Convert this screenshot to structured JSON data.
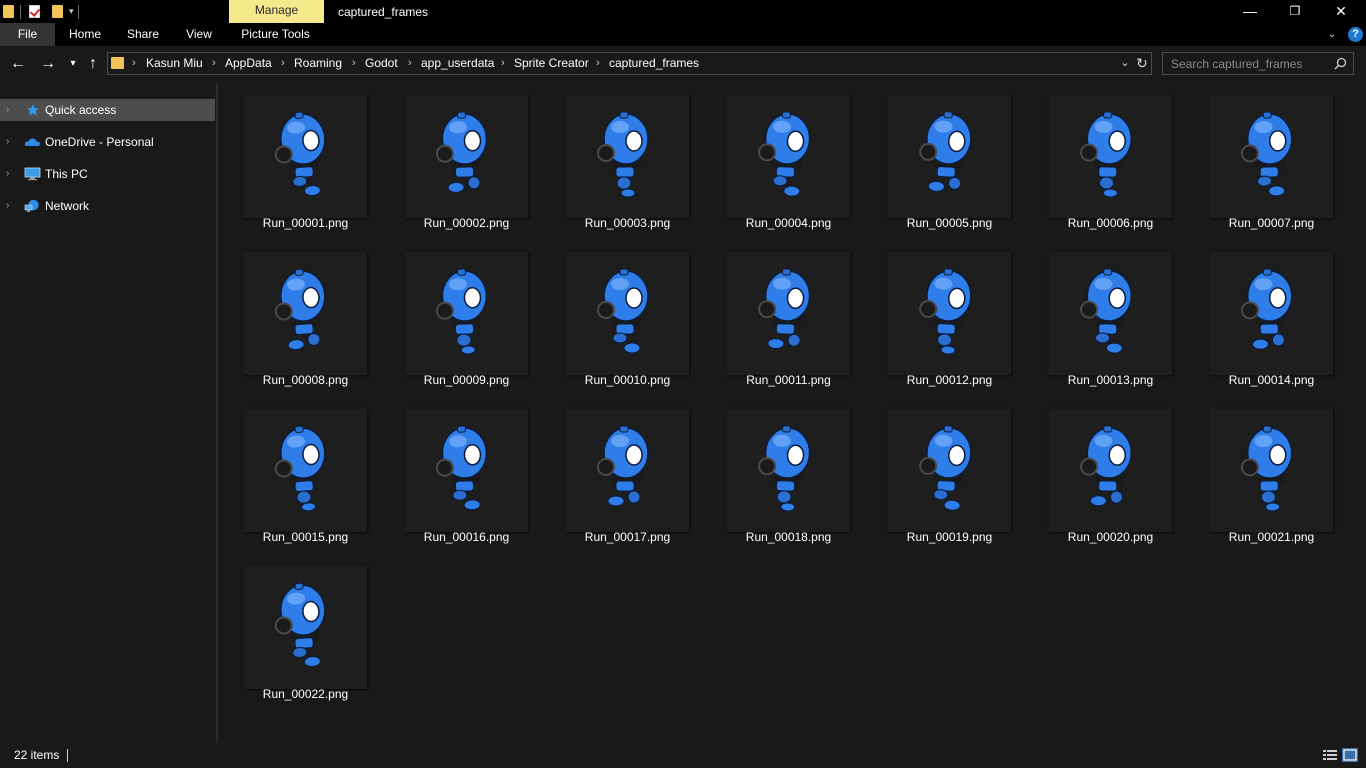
{
  "titlebar": {
    "title": "captured_frames",
    "manage_tab": "Manage",
    "minimize": "—",
    "maximize": "❐",
    "close": "✕"
  },
  "ribbon": {
    "tabs": [
      "File",
      "Home",
      "Share",
      "View",
      "Picture Tools"
    ]
  },
  "nav": {
    "breadcrumbs": [
      "Kasun Miu",
      "AppData",
      "Roaming",
      "Godot",
      "app_userdata",
      "Sprite Creator",
      "captured_frames"
    ],
    "search_placeholder": "Search captured_frames"
  },
  "sidebar": {
    "items": [
      {
        "label": "Quick access",
        "icon": "star-icon",
        "selected": true
      },
      {
        "label": "OneDrive - Personal",
        "icon": "cloud-icon",
        "selected": false
      },
      {
        "label": "This PC",
        "icon": "computer-icon",
        "selected": false
      },
      {
        "label": "Network",
        "icon": "network-icon",
        "selected": false
      }
    ]
  },
  "files": [
    "Run_00001.png",
    "Run_00002.png",
    "Run_00003.png",
    "Run_00004.png",
    "Run_00005.png",
    "Run_00006.png",
    "Run_00007.png",
    "Run_00008.png",
    "Run_00009.png",
    "Run_00010.png",
    "Run_00011.png",
    "Run_00012.png",
    "Run_00013.png",
    "Run_00014.png",
    "Run_00015.png",
    "Run_00016.png",
    "Run_00017.png",
    "Run_00018.png",
    "Run_00019.png",
    "Run_00020.png",
    "Run_00021.png",
    "Run_00022.png"
  ],
  "status": {
    "item_count": "22 items"
  },
  "colors": {
    "background": "#191919",
    "manage_tab": "#f5e98c",
    "selected_item": "#4d4d4d",
    "robot_blue": "#2f7de8"
  }
}
